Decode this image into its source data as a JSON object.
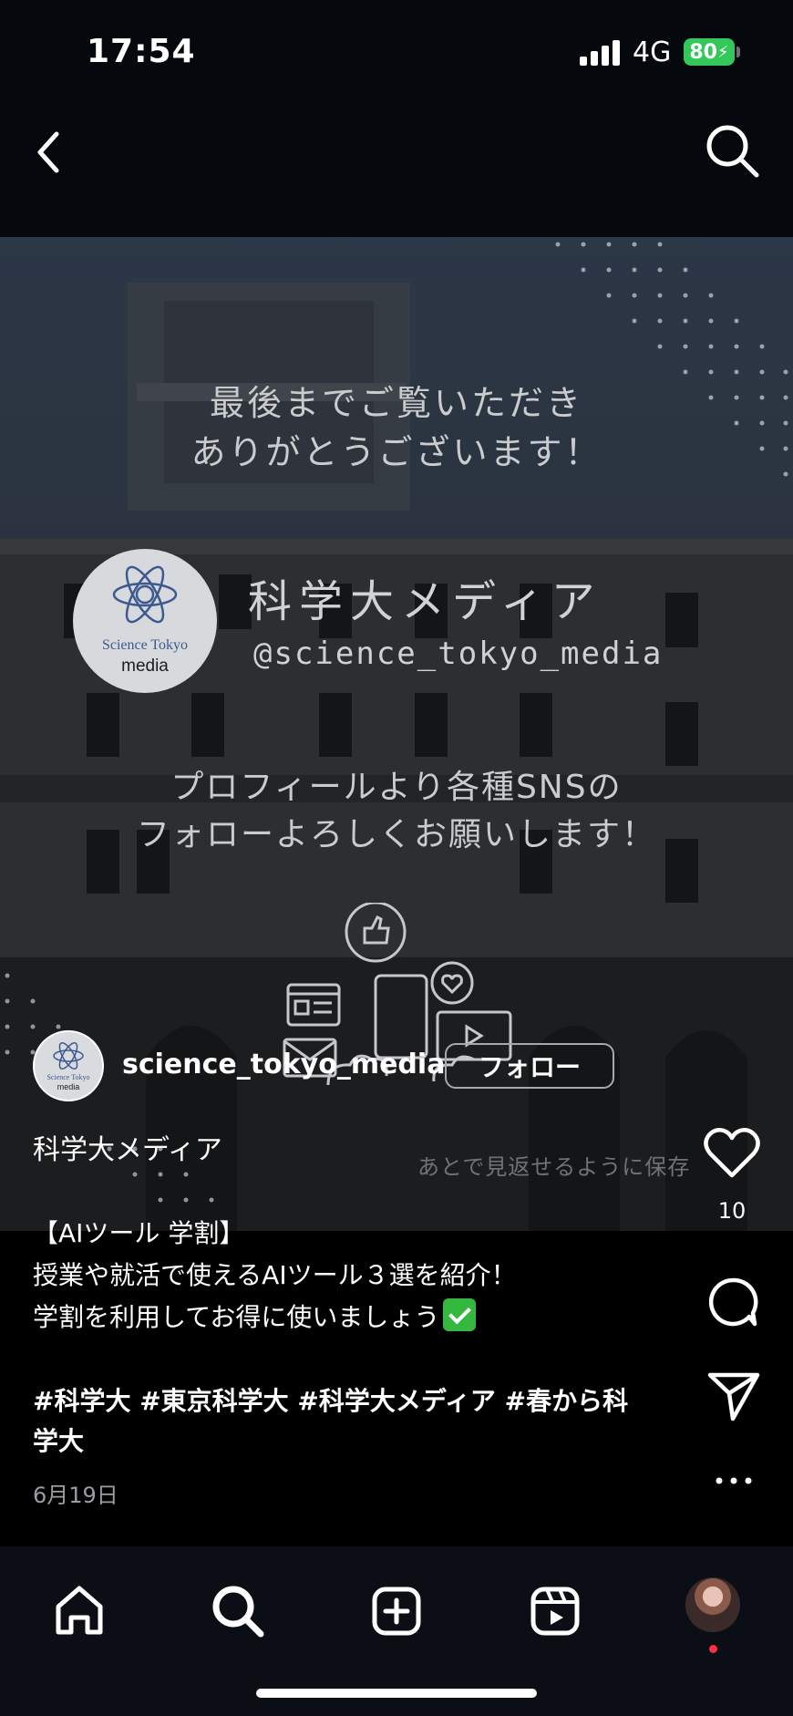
{
  "status_bar": {
    "time": "17:54",
    "network": "4G",
    "battery": "80"
  },
  "post_image": {
    "thanks_line1": "最後までご覧いただき",
    "thanks_line2": "ありがとうございます！",
    "logo_line1": "Science Tokyo",
    "logo_line2": "media",
    "brand_name": "科学大メディア",
    "brand_handle": "@science_tokyo_media",
    "follow_line1": "プロフィールより各種SNSの",
    "follow_line2": "フォローよろしくお願いします！",
    "save_hint": "あとで見返せるように保存"
  },
  "author": {
    "username": "science_tokyo_media",
    "follow_label": "フォロー",
    "avatar_line1": "Science Tokyo",
    "avatar_line2": "media",
    "account_name": "科学大メディア"
  },
  "actions": {
    "like_count": "10"
  },
  "caption": {
    "line1": "【AIツール 学割】",
    "line2": "授業や就活で使えるAIツール３選を紹介！",
    "line3": "学割を利用してお得に使いましょう",
    "hashtags": "#科学大 #東京科学大 #科学大メディア #春から科学大",
    "date": "6月19日"
  },
  "icons": {
    "back": "chevron-left-icon",
    "search": "search-icon",
    "like": "heart-icon",
    "comment": "comment-icon",
    "share": "send-icon",
    "more": "more-dots-icon",
    "nav": [
      "home-icon",
      "search-icon",
      "create-icon",
      "reels-icon",
      "profile-avatar"
    ]
  },
  "colors": {
    "battery": "#34c759",
    "checkmark": "#35b83f",
    "notification_dot": "#ff3040"
  }
}
